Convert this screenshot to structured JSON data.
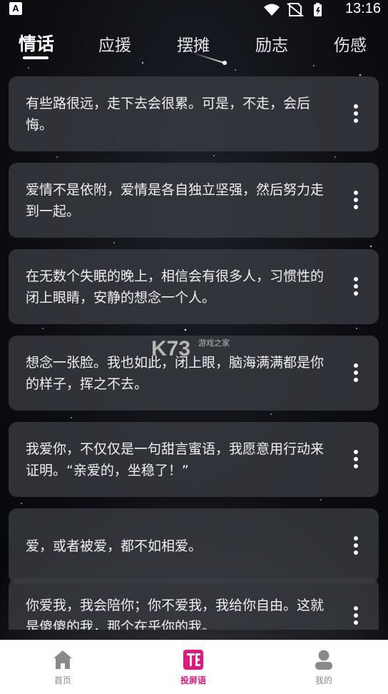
{
  "status_bar": {
    "notification_icon": "A",
    "time": "13:16"
  },
  "tabs": [
    {
      "label": "情话",
      "active": true
    },
    {
      "label": "应援",
      "active": false
    },
    {
      "label": "摆摊",
      "active": false
    },
    {
      "label": "励志",
      "active": false
    },
    {
      "label": "伤感",
      "active": false
    }
  ],
  "items": [
    {
      "text": "有些路很远，走下去会很累。可是，不走，会后悔。"
    },
    {
      "text": "爱情不是依附，爱情是各自独立坚强，然后努力走到一起。"
    },
    {
      "text": "在无数个失眠的晚上，相信会有很多人，习惯性的闭上眼睛，安静的想念一个人。"
    },
    {
      "text": "想念一张脸。我也如此，闭上眼，脑海满满都是你的样子，挥之不去。"
    },
    {
      "text": "我爱你，不仅仅是一句甜言蜜语，我愿意用行动来证明。“亲爱的，坐稳了！”"
    },
    {
      "text": "爱，或者被爱，都不如相爱。"
    },
    {
      "text": "你爱我，我会陪你；你不爱我，我给你自由。这就是傻傻的我，那个在乎你的我。"
    }
  ],
  "watermark": {
    "brand": "K73",
    "sub": "游戏之家"
  },
  "bottom_nav": [
    {
      "label": "首页",
      "icon": "home-icon",
      "active": false
    },
    {
      "label": "投屏语",
      "icon": "screen-text-icon",
      "active": true
    },
    {
      "label": "我的",
      "icon": "profile-icon",
      "active": false
    }
  ],
  "colors": {
    "accent": "#e3177e",
    "card_bg": "#3a3c42",
    "nav_inactive": "#8a8a8a"
  }
}
